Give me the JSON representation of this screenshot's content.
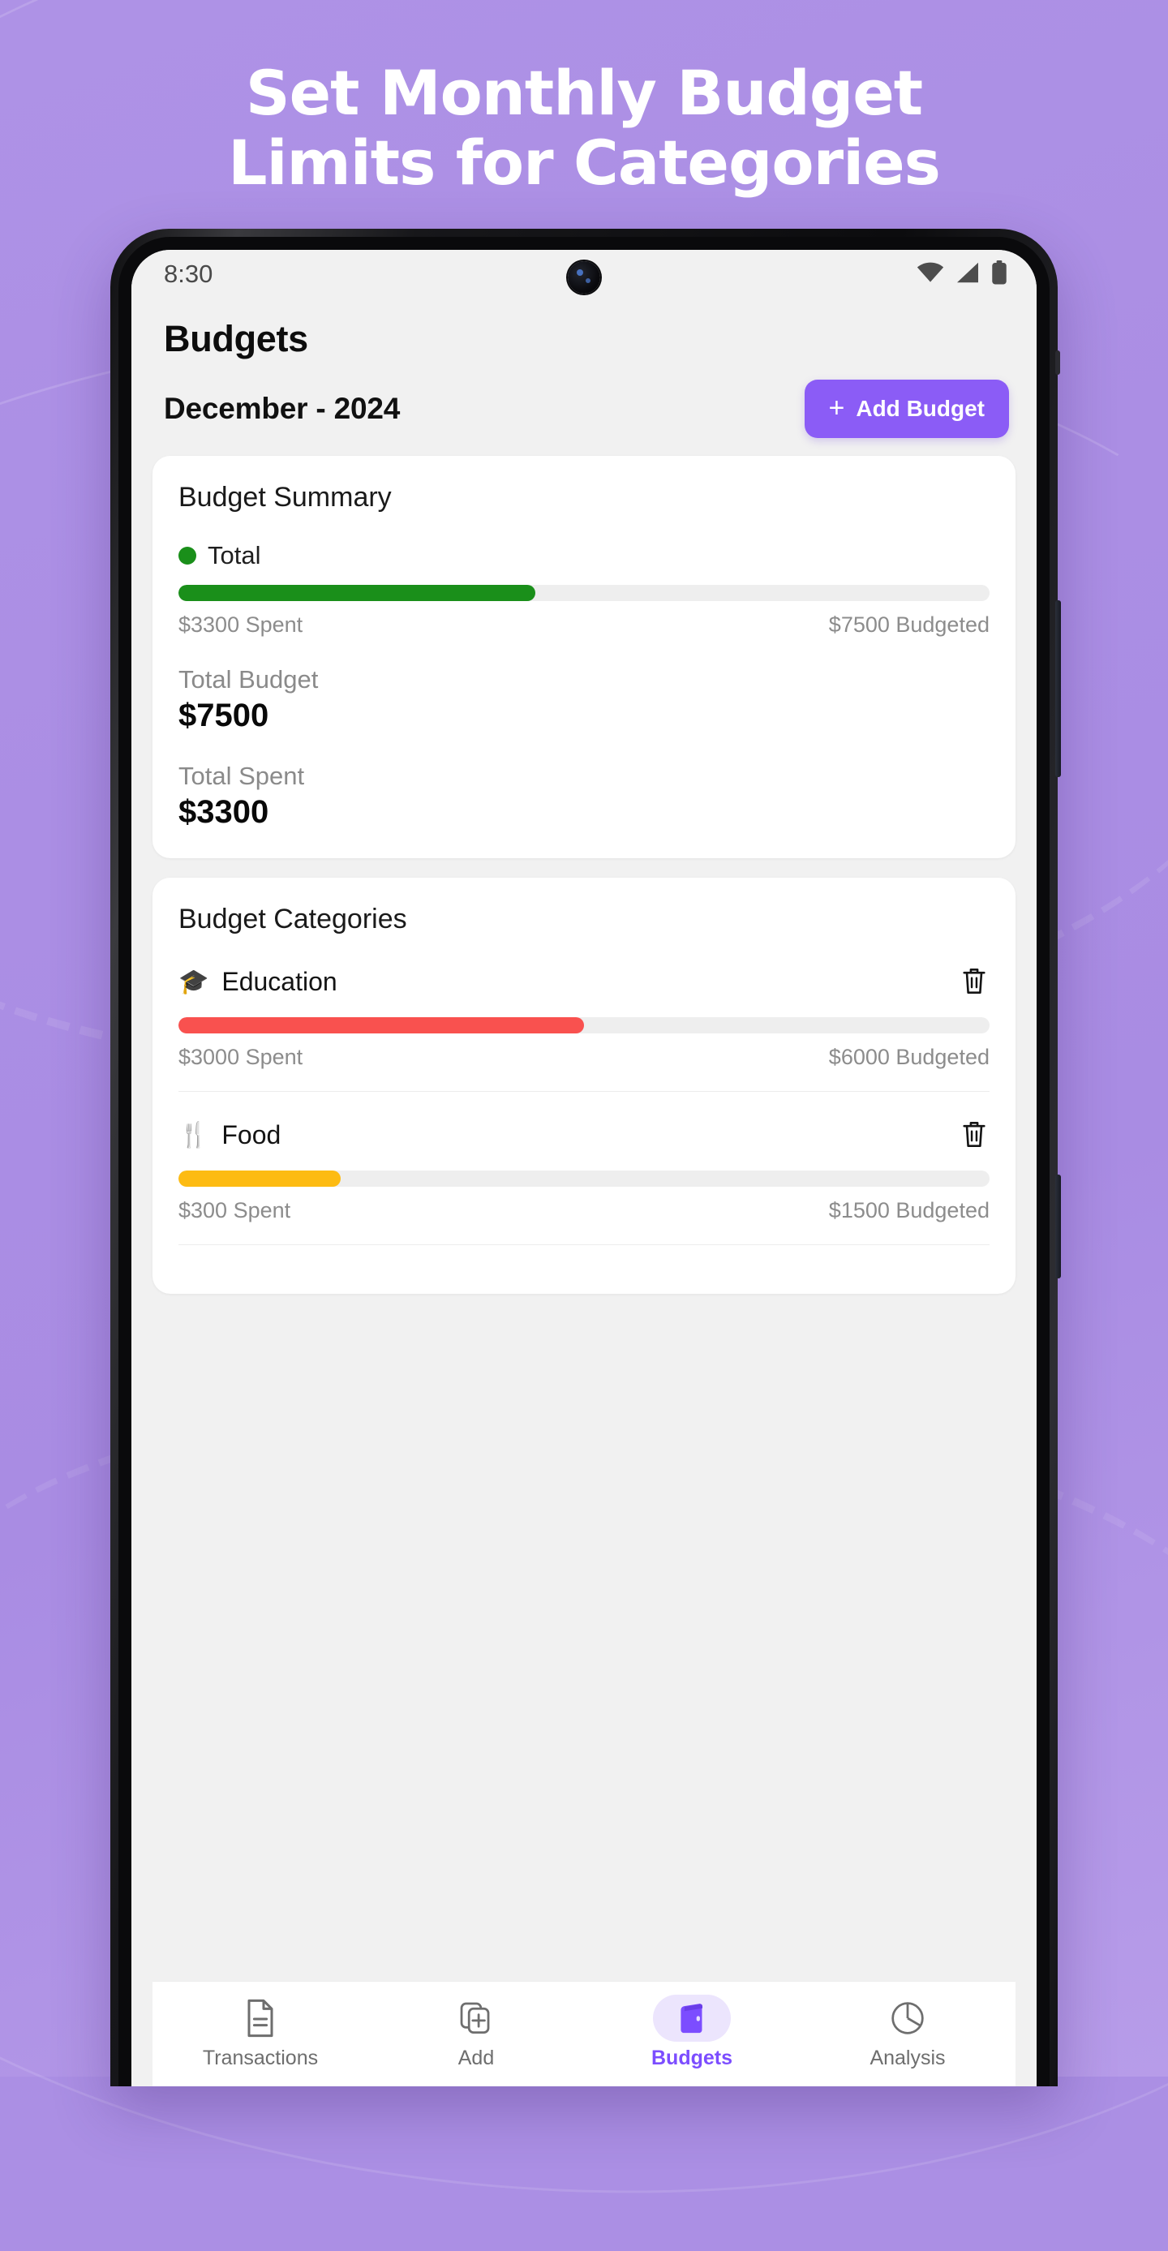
{
  "promo": {
    "heading_line1": "Set Monthly Budget",
    "heading_line2": "Limits for Categories",
    "bg_color": "#ab8fe4",
    "heading_color": "#ffffff"
  },
  "status_bar": {
    "time": "8:30",
    "wifi_icon": "wifi-icon",
    "signal_icon": "cellular-signal-icon",
    "battery_icon": "battery-icon"
  },
  "header": {
    "title": "Budgets",
    "date_label": "December - 2024",
    "add_button_label": "Add Budget",
    "add_button_plus": "+",
    "accent_color": "#8b5cf6"
  },
  "summary_card": {
    "title": "Budget Summary",
    "legend_label": "Total",
    "legend_color": "#1a8f1a",
    "progress_percent": 44,
    "spent_text": "$3300 Spent",
    "budgeted_text": "$7500 Budgeted",
    "stats": [
      {
        "label": "Total Budget",
        "value": "$7500"
      },
      {
        "label": "Total Spent",
        "value": "$3300"
      }
    ]
  },
  "categories_card": {
    "title": "Budget Categories",
    "delete_icon": "trash-icon",
    "items": [
      {
        "name": "Education",
        "icon": "graduation-cap-icon",
        "icon_glyph": "🎓",
        "bar_color": "#f9514f",
        "progress_percent": 50,
        "spent_text": "$3000 Spent",
        "budgeted_text": "$6000 Budgeted"
      },
      {
        "name": "Food",
        "icon": "fork-knife-icon",
        "icon_glyph": "🍴",
        "bar_color": "#fdbb12",
        "progress_percent": 20,
        "spent_text": "$300 Spent",
        "budgeted_text": "$1500 Budgeted"
      }
    ]
  },
  "bottom_nav": {
    "active_color": "#7c4dff",
    "items": [
      {
        "label": "Transactions",
        "icon": "document-icon",
        "active": false
      },
      {
        "label": "Add",
        "icon": "add-document-icon",
        "active": false
      },
      {
        "label": "Budgets",
        "icon": "wallet-icon",
        "active": true
      },
      {
        "label": "Analysis",
        "icon": "pie-chart-icon",
        "active": false
      }
    ]
  }
}
